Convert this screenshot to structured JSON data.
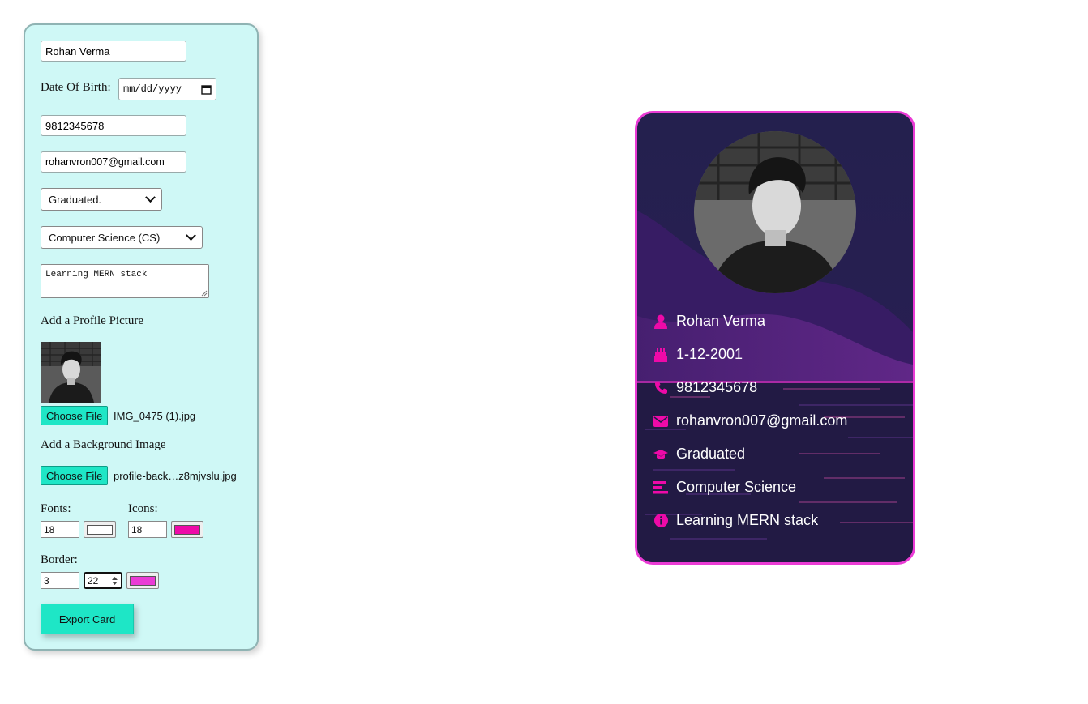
{
  "form": {
    "name_value": "Rohan Verma",
    "dob_label": "Date Of Birth:",
    "dob_placeholder": "mm/dd/yyyy",
    "phone_value": "9812345678",
    "email_value": "rohanvron007@gmail.com",
    "education_selected": "Graduated.",
    "branch_selected": "Computer Science (CS)",
    "bio_value": "Learning MERN stack",
    "profile_picture_label": "Add a Profile Picture",
    "profile_file_button": "Choose File",
    "profile_file_name": "IMG_0475 (1).jpg",
    "background_label": "Add a Background Image",
    "background_file_button": "Choose File",
    "background_file_name": "profile-back…z8mjvslu.jpg",
    "fonts_label": "Fonts:",
    "fonts_size": "18",
    "fonts_color": "#ffffff",
    "icons_label": "Icons:",
    "icons_size": "18",
    "icons_color": "#ee0aa8",
    "border_label": "Border:",
    "border_width": "3",
    "border_radius": "22",
    "border_color": "#ea3bd5",
    "export_button": "Export Card"
  },
  "card": {
    "rows": [
      {
        "icon": "user-icon",
        "value": "Rohan Verma"
      },
      {
        "icon": "birthday-cake-icon",
        "value": "1-12-2001"
      },
      {
        "icon": "phone-icon",
        "value": "9812345678"
      },
      {
        "icon": "envelope-icon",
        "value": "rohanvron007@gmail.com"
      },
      {
        "icon": "graduation-cap-icon",
        "value": "Graduated"
      },
      {
        "icon": "bars-icon",
        "value": "Computer Science"
      },
      {
        "icon": "info-circle-icon",
        "value": "Learning MERN stack"
      }
    ],
    "accent_color": "#ee0aa8"
  }
}
